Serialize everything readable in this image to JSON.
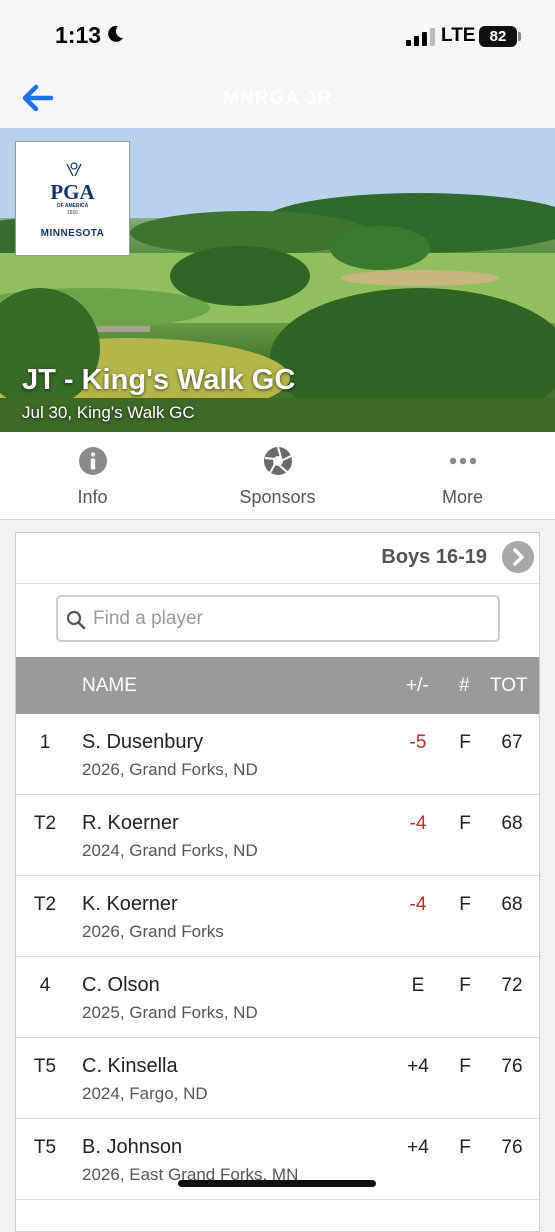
{
  "status": {
    "time": "1:13",
    "network": "LTE",
    "battery": "82"
  },
  "nav": {
    "title": "MNRGA JR"
  },
  "event": {
    "title": "JT - King's Walk GC",
    "subtitle": "Jul 30, King's Walk GC",
    "logo": {
      "pga": "PGA",
      "of_america": "OF AMERICA",
      "year": "1916",
      "region": "MINNESOTA"
    }
  },
  "tabs": [
    {
      "label": "Info",
      "icon": "info-icon"
    },
    {
      "label": "Sponsors",
      "icon": "aperture-icon"
    },
    {
      "label": "More",
      "icon": "more-dots-icon"
    }
  ],
  "leaderboard": {
    "division": "Boys 16-19",
    "search_placeholder": "Find a player",
    "columns": {
      "name": "NAME",
      "plus_minus": "+/-",
      "thru": "#",
      "total": "TOT"
    },
    "rows": [
      {
        "pos": "1",
        "name": "S. Dusenbury",
        "info": "2026, Grand Forks, ND",
        "pm": "-5",
        "thru": "F",
        "tot": "67",
        "under": true
      },
      {
        "pos": "T2",
        "name": "R. Koerner",
        "info": "2024, Grand Forks, ND",
        "pm": "-4",
        "thru": "F",
        "tot": "68",
        "under": true
      },
      {
        "pos": "T2",
        "name": "K. Koerner",
        "info": "2026, Grand Forks",
        "pm": "-4",
        "thru": "F",
        "tot": "68",
        "under": true
      },
      {
        "pos": "4",
        "name": "C. Olson",
        "info": "2025, Grand Forks, ND",
        "pm": "E",
        "thru": "F",
        "tot": "72",
        "under": false
      },
      {
        "pos": "T5",
        "name": "C. Kinsella",
        "info": "2024, Fargo, ND",
        "pm": "+4",
        "thru": "F",
        "tot": "76",
        "under": false
      },
      {
        "pos": "T5",
        "name": "B. Johnson",
        "info": "2026, East Grand Forks, MN",
        "pm": "+4",
        "thru": "F",
        "tot": "76",
        "under": false
      }
    ]
  },
  "colors": {
    "accent": "#1a73e8",
    "under_par": "#c62828",
    "header_bg": "#9a9a9a"
  }
}
